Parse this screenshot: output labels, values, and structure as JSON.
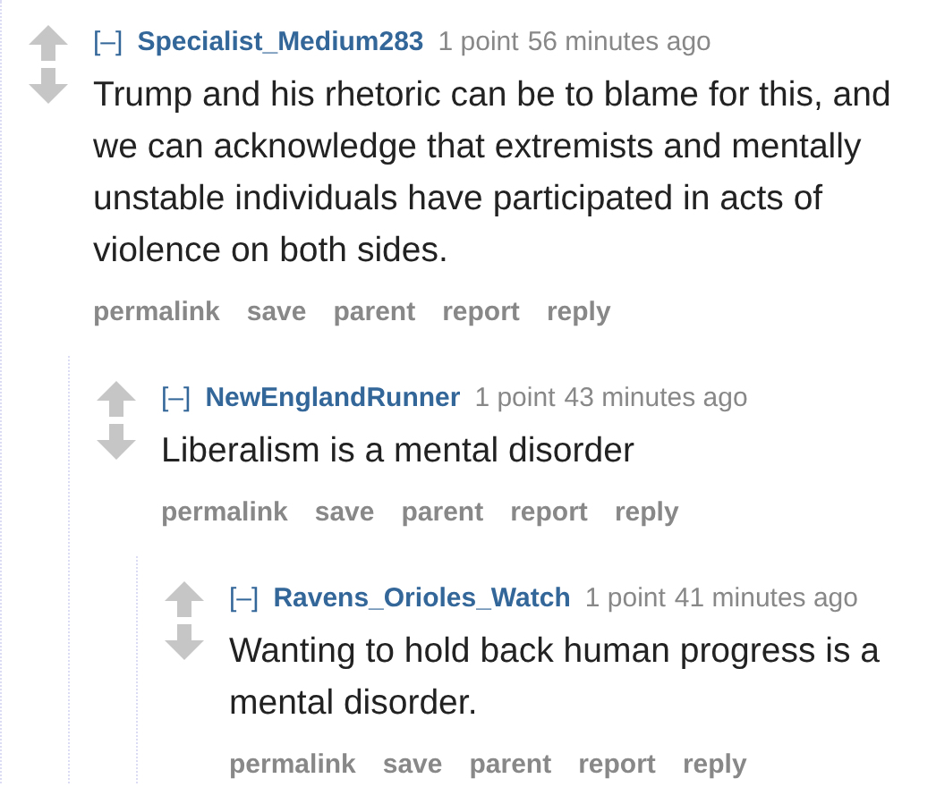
{
  "comments": [
    {
      "toggle": "[–]",
      "author": "Specialist_Medium283",
      "score": "1 point",
      "time": "56 minutes ago",
      "body": "Trump and his rhetoric can be to blame for this, and we can acknowledge that extremists and mentally unstable individuals have participated in acts of violence on both sides.",
      "actions": [
        "permalink",
        "save",
        "parent",
        "report",
        "reply"
      ],
      "children": [
        {
          "toggle": "[–]",
          "author": "NewEnglandRunner",
          "score": "1 point",
          "time": "43 minutes ago",
          "body": "Liberalism is a mental disorder",
          "actions": [
            "permalink",
            "save",
            "parent",
            "report",
            "reply"
          ],
          "children": [
            {
              "toggle": "[–]",
              "author": "Ravens_Orioles_Watch",
              "score": "1 point",
              "time": "41 minutes ago",
              "body": "Wanting to hold back human progress is a mental disorder.",
              "actions": [
                "permalink",
                "save",
                "parent",
                "report",
                "reply"
              ]
            }
          ]
        }
      ]
    }
  ]
}
